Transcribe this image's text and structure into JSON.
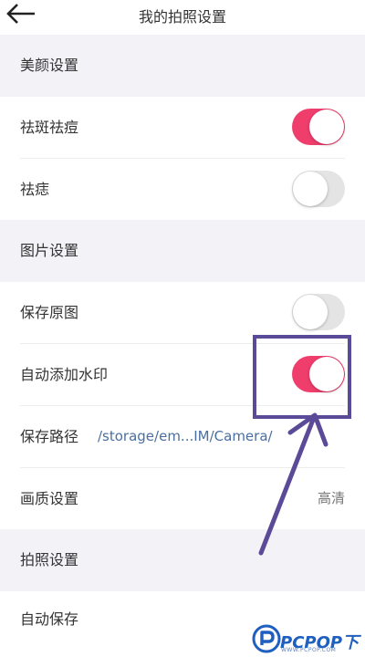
{
  "header": {
    "title": "我的拍照设置",
    "back_icon": "arrow-left-icon"
  },
  "sections": {
    "beauty": "美颜设置",
    "picture": "图片设置",
    "photo": "拍照设置"
  },
  "rows": {
    "spot_remover": {
      "label": "祛斑祛痘",
      "enabled": true
    },
    "acne_remover": {
      "label": "祛痣",
      "enabled": false
    },
    "save_original": {
      "label": "保存原图",
      "enabled": false
    },
    "auto_watermark": {
      "label": "自动添加水印",
      "enabled": true
    },
    "save_path": {
      "label": "保存路径",
      "value": "/storage/em...IM/Camera/"
    },
    "quality": {
      "label": "画质设置",
      "value": "高清"
    },
    "auto_save": {
      "label": "自动保存"
    }
  },
  "colors": {
    "toggle_on": "#ef3d6c",
    "toggle_off": "#e4e4e4",
    "annotation": "#5a4a98",
    "section_bg": "#f3f2f6"
  },
  "watermark": {
    "text": "PCPOP下载",
    "subtext": "WWW.PCPOP.COM"
  }
}
